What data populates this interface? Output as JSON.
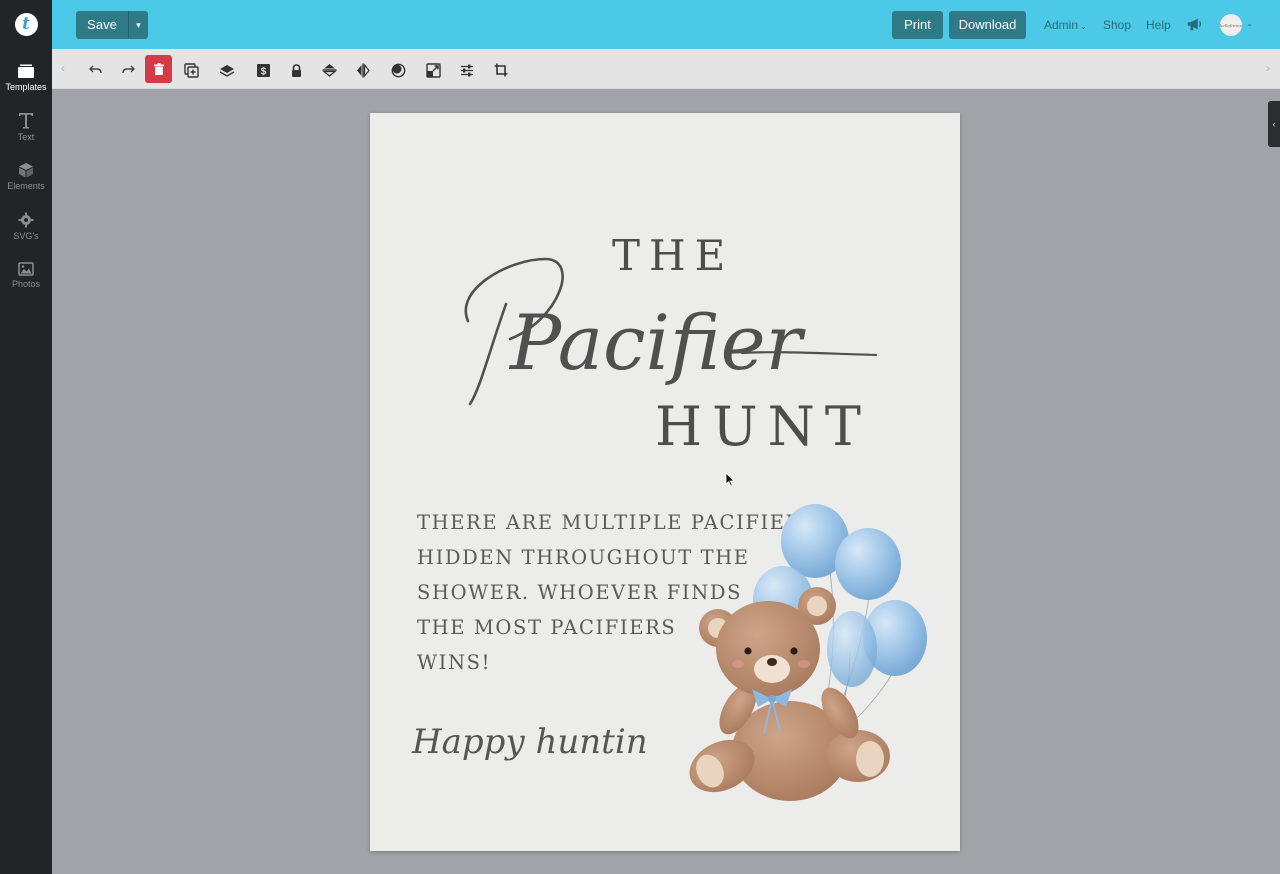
{
  "app": {
    "logo_letter": "t",
    "accent_color": "#4cc9e6",
    "button_color": "#2e7a87",
    "delete_color": "#d63a47"
  },
  "topbar": {
    "save_label": "Save",
    "print_label": "Print",
    "download_label": "Download",
    "admin_label": "Admin",
    "shop_label": "Shop",
    "help_label": "Help",
    "avatar_text": "hellofresco"
  },
  "sidebar": {
    "items": [
      {
        "label": "Templates",
        "icon": "templates-icon",
        "active": true
      },
      {
        "label": "Text",
        "icon": "text-icon",
        "active": false
      },
      {
        "label": "Elements",
        "icon": "cube-icon",
        "active": false
      },
      {
        "label": "SVG's",
        "icon": "gear-icon",
        "active": false
      },
      {
        "label": "Photos",
        "icon": "image-icon",
        "active": false
      }
    ]
  },
  "toolbar": {
    "tools": [
      "undo-icon",
      "redo-icon",
      "trash-icon",
      "duplicate-icon",
      "layers-icon",
      "dollar-icon",
      "lock-icon",
      "flip-vertical-icon",
      "flip-horizontal-icon",
      "mask-icon",
      "resize-icon",
      "adjust-sliders-icon",
      "crop-icon"
    ]
  },
  "poster": {
    "the": "THE",
    "script_title": "Pacifier",
    "hunt": "HUNT",
    "body_lines": [
      "THERE ARE MULTIPLE PACIFIERS",
      "HIDDEN THROUGHOUT THE",
      "SHOWER. WHOEVER FINDS",
      "THE MOST PACIFIERS",
      "WINS!"
    ],
    "closing": "Happy hunting!",
    "text_color": "#4d4d4d",
    "balloon_color": "#9cc4e8",
    "bear_color": "#b5876a"
  }
}
